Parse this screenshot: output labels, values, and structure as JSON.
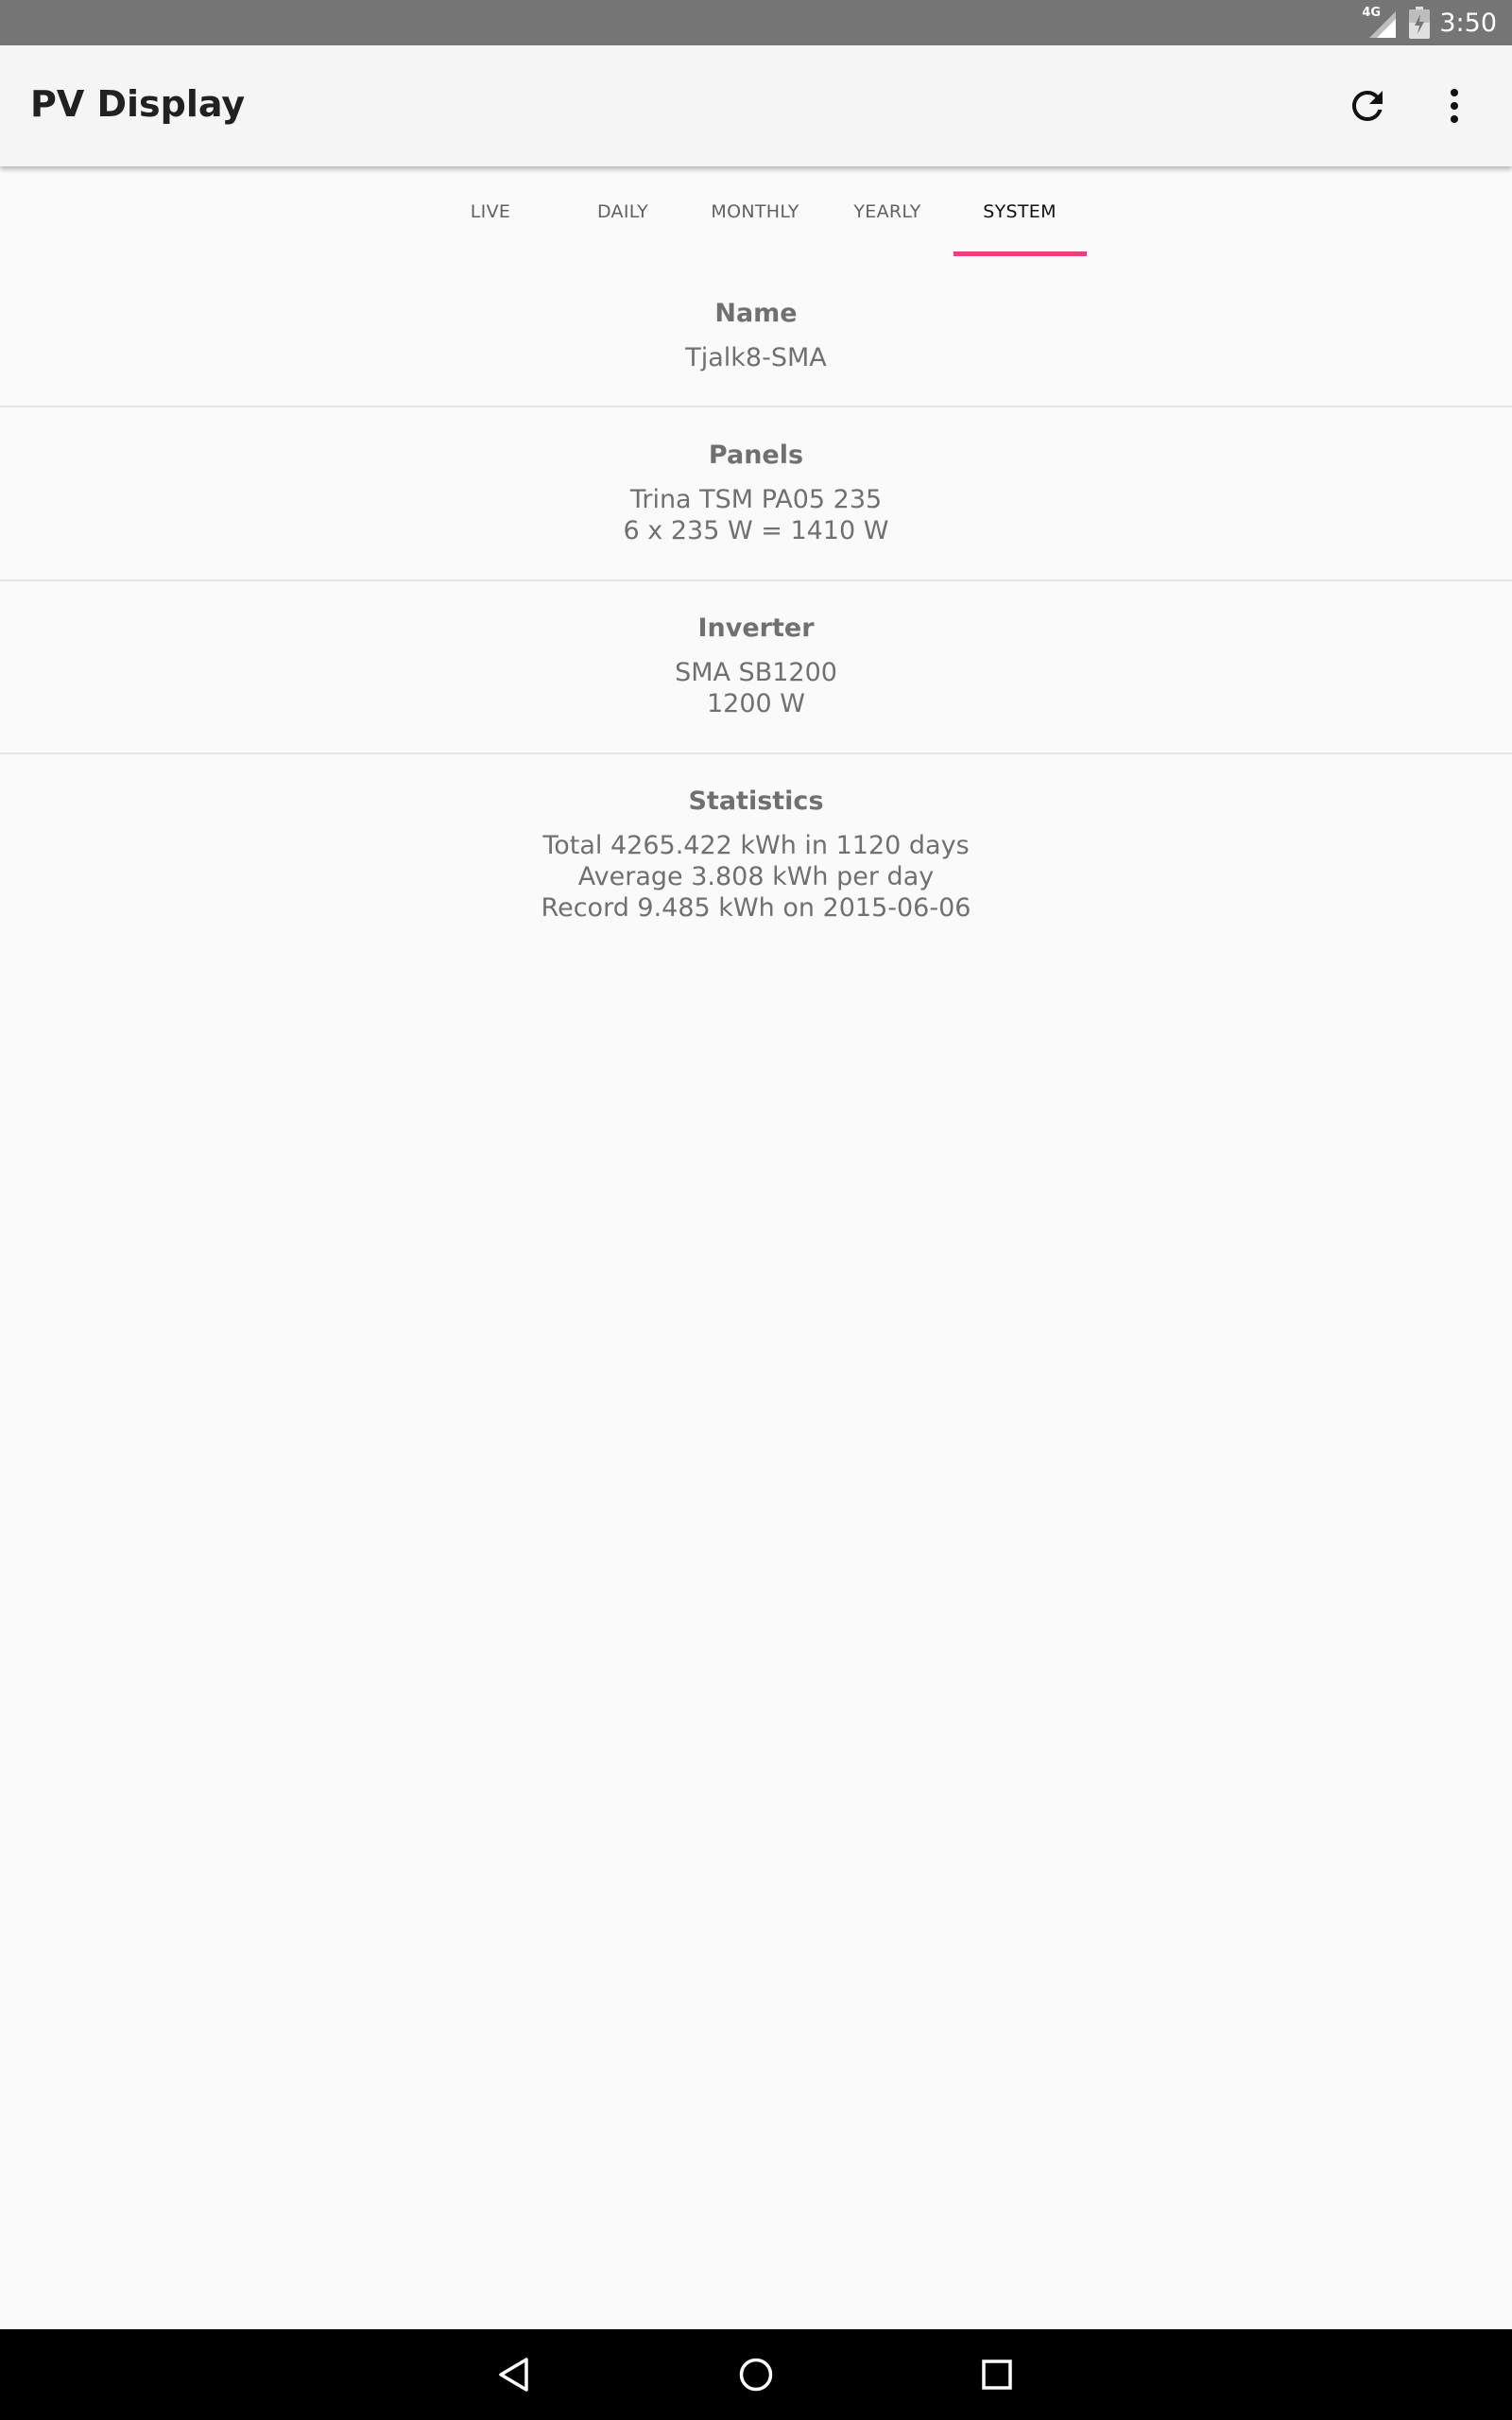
{
  "status_bar": {
    "network_label": "4G",
    "time": "3:50",
    "icons": [
      "signal-icon",
      "battery-charging-icon"
    ]
  },
  "app_bar": {
    "title": "PV Display",
    "actions": [
      "refresh-icon",
      "more-vert-icon"
    ]
  },
  "tabs": [
    {
      "label": "LIVE",
      "active": false
    },
    {
      "label": "DAILY",
      "active": false
    },
    {
      "label": "MONTHLY",
      "active": false
    },
    {
      "label": "YEARLY",
      "active": false
    },
    {
      "label": "SYSTEM",
      "active": true
    }
  ],
  "system": {
    "name": {
      "title": "Name",
      "lines": [
        "Tjalk8-SMA"
      ]
    },
    "panels": {
      "title": "Panels",
      "lines": [
        "Trina TSM PA05 235",
        "6 x 235 W = 1410 W"
      ]
    },
    "inverter": {
      "title": "Inverter",
      "lines": [
        "SMA SB1200",
        "1200 W"
      ]
    },
    "statistics": {
      "title": "Statistics",
      "lines": [
        "Total 4265.422 kWh in 1120 days",
        "Average 3.808 kWh per day",
        "Record 9.485 kWh on 2015-06-06"
      ]
    }
  },
  "nav_bar": {
    "icons": [
      "back-icon",
      "home-icon",
      "recents-icon"
    ]
  },
  "colors": {
    "status_bar": "#757575",
    "app_bar": "#f5f5f5",
    "tab_indicator": "#ec407a",
    "background": "#fafafa",
    "nav_bar": "#000000"
  }
}
